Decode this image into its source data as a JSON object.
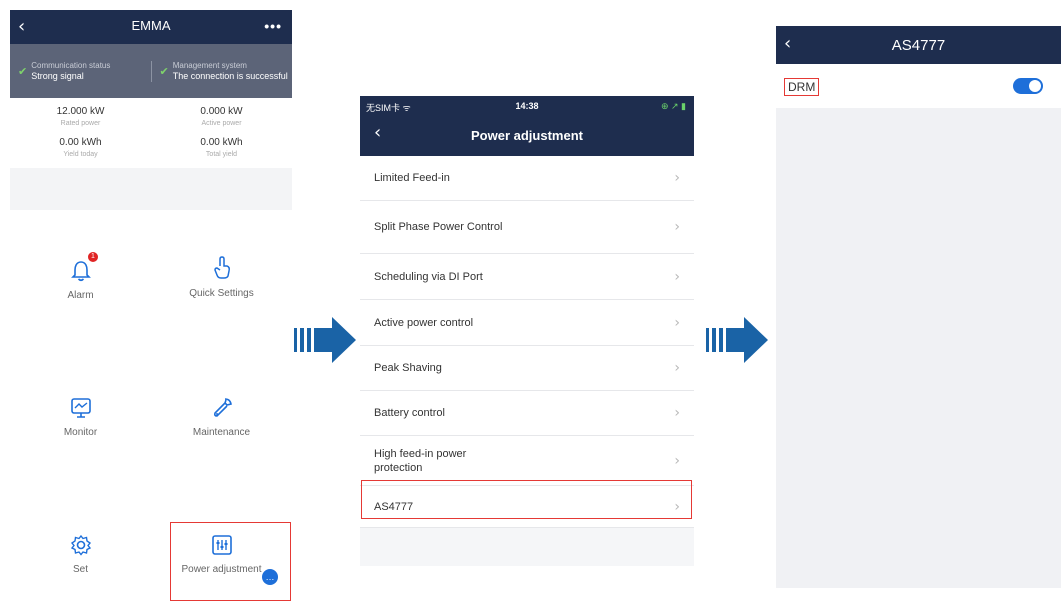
{
  "panel1": {
    "header": {
      "back_icon": "‹",
      "title": "EMMA",
      "more_icon": "•••"
    },
    "status": [
      {
        "caption": "Communication status",
        "value": "Strong signal"
      },
      {
        "caption": "Management system",
        "value": "The connection is successful"
      }
    ],
    "stats": [
      {
        "value": "12.000 kW",
        "label": "Rated power"
      },
      {
        "value": "0.000 kW",
        "label": "Active power"
      },
      {
        "value": "0.00 kWh",
        "label": "Yield today"
      },
      {
        "value": "0.00 kWh",
        "label": "Total yield"
      }
    ],
    "tiles": {
      "alarm": {
        "label": "Alarm",
        "badge": "1"
      },
      "quick_settings": {
        "label": "Quick Settings"
      },
      "monitor": {
        "label": "Monitor"
      },
      "maintenance": {
        "label": "Maintenance"
      },
      "set": {
        "label": "Set"
      },
      "power_adjustment": {
        "label": "Power adjustment"
      }
    },
    "accent_color": "#1e6fd9",
    "header_color": "#1e2d4e"
  },
  "panel2": {
    "statusbar": {
      "carrier": "无SIM卡 ᯤ",
      "time": "14:38",
      "right": "⊕ ↗ ▮"
    },
    "header": {
      "back_icon": "‹",
      "title": "Power adjustment"
    },
    "items": [
      {
        "label": "Limited Feed-in"
      },
      {
        "label": "Split Phase Power Control"
      },
      {
        "label": "Scheduling via DI Port"
      },
      {
        "label": "Active power control"
      },
      {
        "label": "Peak Shaving"
      },
      {
        "label": "Battery control"
      },
      {
        "label": "High feed-in power protection"
      },
      {
        "label": "AS4777"
      }
    ],
    "chevron_icon": "›"
  },
  "panel3": {
    "header": {
      "back_icon": "‹",
      "title": "AS4777"
    },
    "setting": {
      "label": "DRM",
      "toggle_on": true
    }
  },
  "highlight_color": "#e53935",
  "arrow_color": "#1a63a6"
}
